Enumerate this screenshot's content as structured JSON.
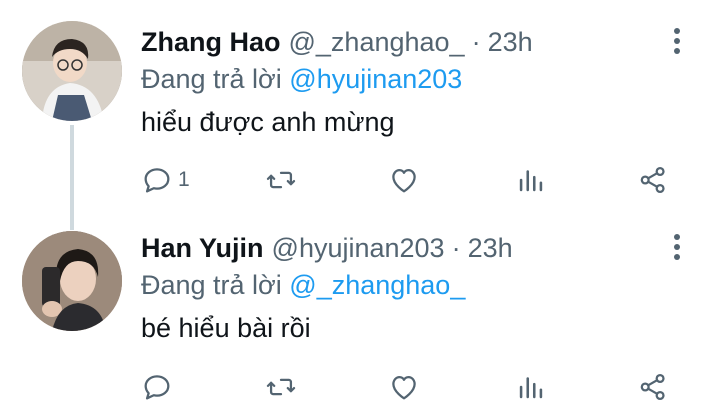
{
  "tweets": [
    {
      "author_name": "Zhang Hao",
      "handle": "@_zhanghao_",
      "separator": "·",
      "time": "23h",
      "reply_prefix": "Đang trả lời",
      "reply_to": "@hyujinan203",
      "text": "hiểu được anh mừng",
      "reply_count": "1"
    },
    {
      "author_name": "Han Yujin",
      "handle": "@hyujinan203",
      "separator": "·",
      "time": "23h",
      "reply_prefix": "Đang trả lời",
      "reply_to": "@_zhanghao_",
      "text": "bé hiểu bài rồi",
      "reply_count": ""
    }
  ],
  "icons": {
    "reply": "reply-icon",
    "retweet": "retweet-icon",
    "like": "heart-icon",
    "views": "analytics-icon",
    "share": "share-icon",
    "more": "more-vertical-icon"
  },
  "colors": {
    "link": "#1d9bf0",
    "secondary_text": "#536471",
    "primary_text": "#0f1419",
    "thread_line": "#cfd9de"
  }
}
